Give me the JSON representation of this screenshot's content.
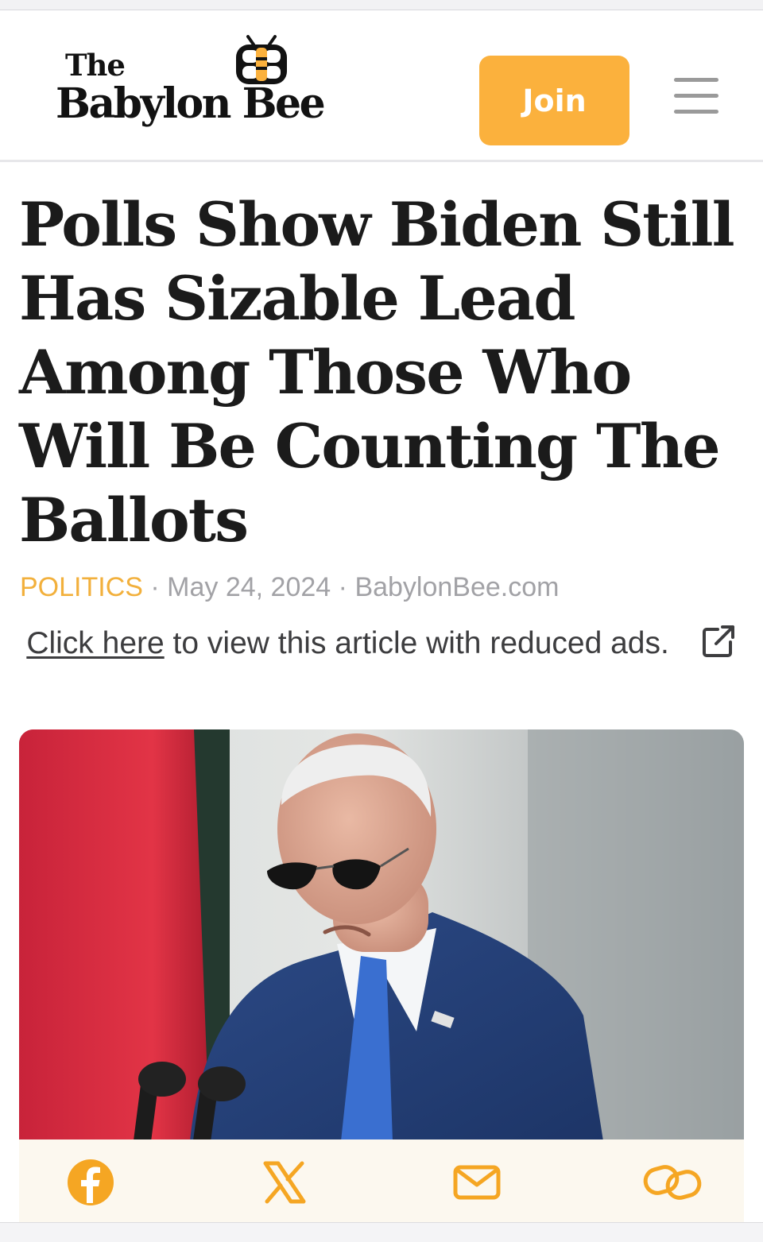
{
  "header": {
    "logo_the": "The",
    "logo_main": "Babylon Bee",
    "join_label": "Join"
  },
  "article": {
    "headline": "Polls Show Biden Still Has Sizable Lead Among Those Who Will Be Counting The Ballots",
    "category": "POLITICS",
    "separator": "·",
    "date": "May 24, 2024",
    "source": "BabylonBee.com",
    "reduced_ads_link": "Click here",
    "reduced_ads_text": " to view this article with reduced ads."
  },
  "share": {
    "icons": [
      "facebook-icon",
      "x-icon",
      "mail-icon",
      "link-icon"
    ]
  },
  "colors": {
    "accent": "#fbb13d",
    "category": "#f2b03c",
    "headline": "#1b1b1b",
    "share_bar_bg": "#fcf8ef"
  }
}
